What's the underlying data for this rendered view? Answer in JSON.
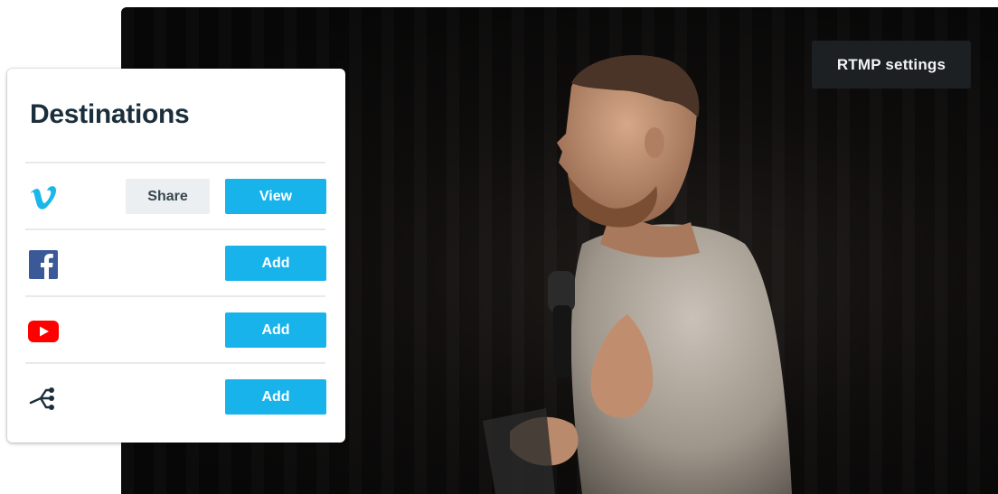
{
  "stage": {
    "rtmp_label": "RTMP settings"
  },
  "destinations": {
    "title": "Destinations",
    "rows": [
      {
        "service": "Vimeo",
        "icon": "vimeo-logo-icon",
        "color": "#1ab7ea",
        "secondary_label": "Share",
        "primary_label": "View"
      },
      {
        "service": "Facebook",
        "icon": "facebook-logo-icon",
        "color": "#3b5998",
        "primary_label": "Add"
      },
      {
        "service": "YouTube",
        "icon": "youtube-logo-icon",
        "color": "#ff0000",
        "primary_label": "Add"
      },
      {
        "service": "Other destination",
        "icon": "branch-share-icon",
        "color": "#1a2e3b",
        "primary_label": "Add"
      }
    ]
  },
  "colors": {
    "accent": "#17b3ea",
    "title": "#1a2e3b",
    "stage_bg": "#0b0a09",
    "rtmp_bg": "#1d2023"
  }
}
